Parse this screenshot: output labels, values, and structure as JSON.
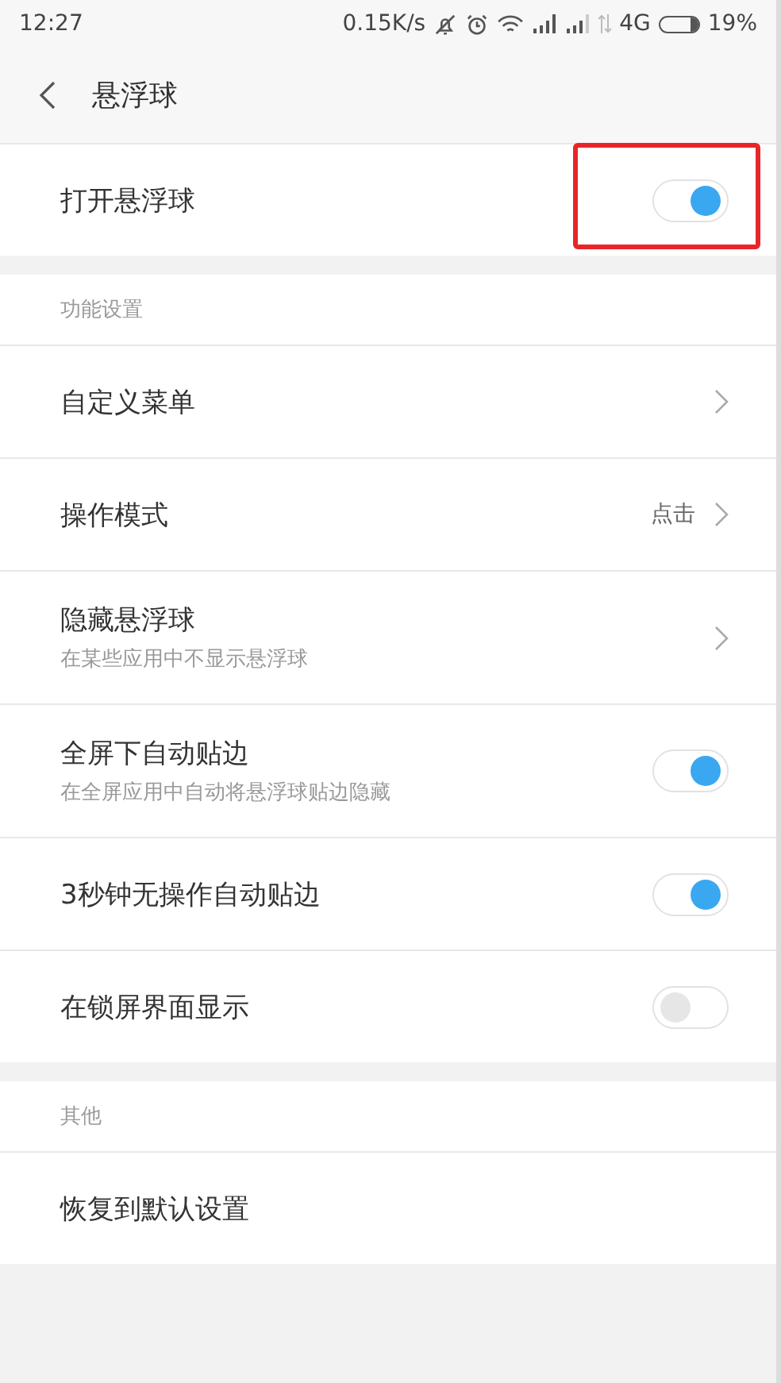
{
  "status_bar": {
    "time": "12:27",
    "network_speed": "0.15K/s",
    "network_type": "4G",
    "battery": "19%"
  },
  "header": {
    "title": "悬浮球"
  },
  "sections": [
    {
      "items": [
        {
          "kind": "switch",
          "label": "打开悬浮球",
          "on": true,
          "highlighted": true
        }
      ]
    },
    {
      "title": "功能设置",
      "items": [
        {
          "kind": "link",
          "label": "自定义菜单"
        },
        {
          "kind": "link",
          "label": "操作模式",
          "value": "点击"
        },
        {
          "kind": "link",
          "label": "隐藏悬浮球",
          "subtitle": "在某些应用中不显示悬浮球"
        },
        {
          "kind": "switch",
          "label": "全屏下自动贴边",
          "subtitle": "在全屏应用中自动将悬浮球贴边隐藏",
          "on": true,
          "highlighted": false
        },
        {
          "kind": "switch",
          "label": "3秒钟无操作自动贴边",
          "on": true,
          "highlighted": false
        },
        {
          "kind": "switch",
          "label": "在锁屏界面显示",
          "on": false,
          "highlighted": false
        }
      ]
    },
    {
      "title": "其他",
      "items": [
        {
          "kind": "action",
          "label": "恢复到默认设置"
        }
      ]
    }
  ]
}
